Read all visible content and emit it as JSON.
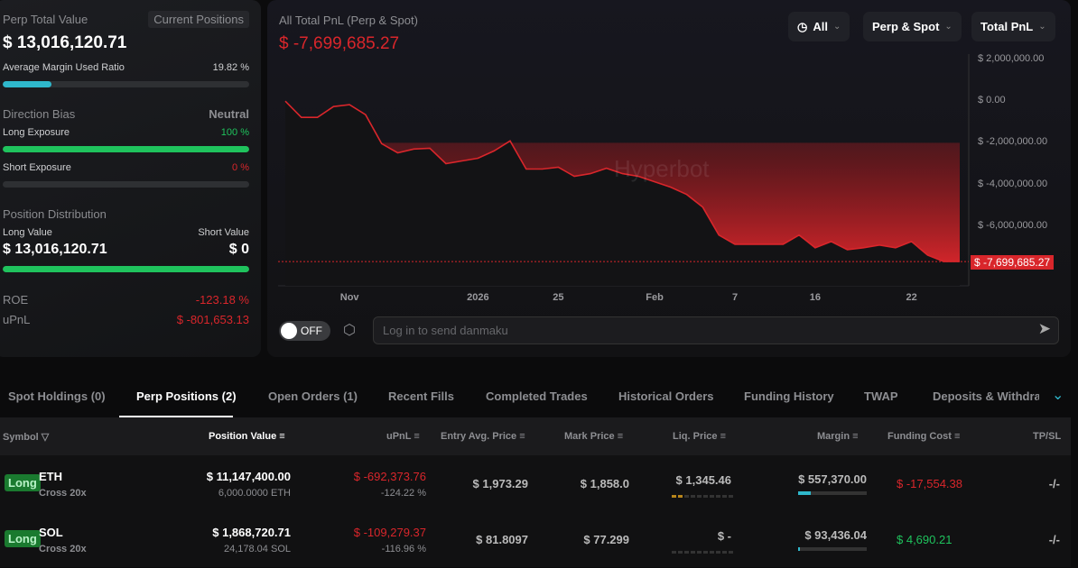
{
  "summary": {
    "perp_total_label": "Perp Total Value",
    "current_positions": "Current Positions",
    "perp_total_value": "$ 13,016,120.71",
    "avg_margin_label": "Average Margin Used Ratio",
    "avg_margin_value": "19.82 %",
    "avg_margin_pct": 19.82,
    "direction_bias_label": "Direction Bias",
    "direction_bias_value": "Neutral",
    "long_exposure_label": "Long Exposure",
    "long_exposure_value": "100 %",
    "long_exposure_pct": 100,
    "short_exposure_label": "Short Exposure",
    "short_exposure_value": "0 %",
    "short_exposure_pct": 0,
    "position_distribution_label": "Position Distribution",
    "long_value_label": "Long Value",
    "short_value_label": "Short Value",
    "long_value": "$ 13,016,120.71",
    "short_value": "$ 0",
    "long_share_pct": 100,
    "roe_label": "ROE",
    "roe_value": "-123.18 %",
    "upnl_label": "uPnL",
    "upnl_value": "$ -801,653.13"
  },
  "chart": {
    "title": "All Total PnL (Perp & Spot)",
    "value": "$ -7,699,685.27",
    "filters": [
      "All",
      "Perp & Spot",
      "Total PnL"
    ],
    "watermark": "Hyperbot",
    "current_label": "$ -7,699,685.27",
    "danmaku_toggle": "OFF",
    "danmaku_placeholder": "Log in to send danmaku"
  },
  "chart_data": {
    "type": "area",
    "title": "All Total PnL (Perp & Spot)",
    "ylim": [
      -8000000,
      2000000
    ],
    "yticks": [
      {
        "v": 2000000,
        "label": "$ 2,000,000.00"
      },
      {
        "v": 0,
        "label": "$ 0.00"
      },
      {
        "v": -2000000,
        "label": "$ -2,000,000.00"
      },
      {
        "v": -4000000,
        "label": "$ -4,000,000.00"
      },
      {
        "v": -6000000,
        "label": "$ -6,000,000.00"
      }
    ],
    "xticks": [
      {
        "i": 4,
        "label": "Nov"
      },
      {
        "i": 12,
        "label": "2026"
      },
      {
        "i": 17,
        "label": "25"
      },
      {
        "i": 23,
        "label": "Feb"
      },
      {
        "i": 28,
        "label": "7"
      },
      {
        "i": 33,
        "label": "16"
      },
      {
        "i": 39,
        "label": "22"
      }
    ],
    "values": [
      0,
      -780000,
      -780000,
      -260000,
      -170000,
      -650000,
      -2040000,
      -2480000,
      -2300000,
      -2260000,
      -3000000,
      -2870000,
      -2740000,
      -2390000,
      -1910000,
      -3260000,
      -3260000,
      -3170000,
      -3610000,
      -3480000,
      -3220000,
      -3480000,
      -3610000,
      -3870000,
      -4130000,
      -4480000,
      -5090000,
      -6430000,
      -6870000,
      -6870000,
      -6870000,
      -6870000,
      -6430000,
      -7040000,
      -6740000,
      -7130000,
      -7040000,
      -6910000,
      -7040000,
      -6740000,
      -7390000,
      -7700000,
      -7699685.27
    ],
    "line_color": "#d9262b"
  },
  "tabs": [
    "Spot Holdings (0)",
    "Perp Positions (2)",
    "Open Orders (1)",
    "Recent Fills",
    "Completed Trades",
    "Historical Orders",
    "Funding History",
    "TWAP",
    "Deposits & Withdraw"
  ],
  "table": {
    "headers": [
      "Symbol",
      "Position Value",
      "uPnL",
      "Entry Avg. Price",
      "Mark Price",
      "Liq. Price",
      "Margin",
      "Funding Cost",
      "TP/SL"
    ],
    "rows": [
      {
        "side": "Long",
        "symbol": "ETH",
        "mode": "Cross 20x",
        "value": "$ 11,147,400.00",
        "size": "6,000.0000 ETH",
        "upnl": "$ -692,373.76",
        "upnl_pct": "-124.22 %",
        "entry": "$ 1,973.29",
        "mark": "$ 1,858.0",
        "liq": "$ 1,345.46",
        "liq_risk": 2,
        "margin": "$ 557,370.00",
        "margin_pct": 18,
        "funding": "$ -17,554.38",
        "funding_color": "#d9262b",
        "tpsl": "-/-"
      },
      {
        "side": "Long",
        "symbol": "SOL",
        "mode": "Cross 20x",
        "value": "$ 1,868,720.71",
        "size": "24,178.04 SOL",
        "upnl": "$ -109,279.37",
        "upnl_pct": "-116.96 %",
        "entry": "$ 81.8097",
        "mark": "$ 77.299",
        "liq": "$ -",
        "liq_risk": 0,
        "margin": "$ 93,436.04",
        "margin_pct": 3,
        "funding": "$ 4,690.21",
        "funding_color": "#1fc35d",
        "tpsl": "-/-"
      }
    ]
  }
}
